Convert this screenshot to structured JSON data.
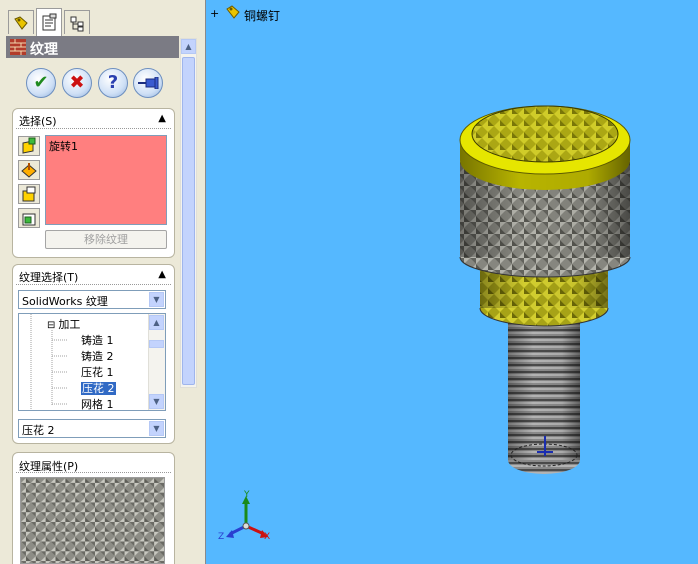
{
  "tabs": [
    {
      "name": "featuremanager-tab"
    },
    {
      "name": "propertymanager-tab"
    },
    {
      "name": "configurationmanager-tab"
    }
  ],
  "pm": {
    "title": "纹理",
    "actions": [
      {
        "name": "ok-button",
        "glyph": "✔",
        "color": "#1f8a1f"
      },
      {
        "name": "cancel-button",
        "glyph": "✖",
        "color": "#cc1111"
      },
      {
        "name": "help-button",
        "glyph": "?",
        "color": "#2a3fb0"
      },
      {
        "name": "pin-button",
        "glyph": "⊸",
        "color": "#2a3fb0"
      }
    ],
    "selection": {
      "header": "选择(S)",
      "item": "旋转1",
      "remove_button": "移除纹理"
    },
    "texture_select": {
      "header": "纹理选择(T)",
      "library_combo": "SolidWorks 纹理",
      "tree": [
        {
          "label": "加工",
          "indent": 1,
          "toggle": "⊟"
        },
        {
          "label": "铸造 1",
          "indent": 2
        },
        {
          "label": "铸造 2",
          "indent": 2
        },
        {
          "label": "压花 1",
          "indent": 2
        },
        {
          "label": "压花 2",
          "indent": 2,
          "selected": true
        },
        {
          "label": "网格 1",
          "indent": 2
        }
      ],
      "selected_combo": "压花 2"
    },
    "texture_props": {
      "header": "纹理属性(P)"
    }
  },
  "viewport": {
    "breadcrumb_expander": "+",
    "breadcrumb": "铜螺钉",
    "triad": {
      "x": "X",
      "y": "Y",
      "z": "Z"
    },
    "colors": {
      "background": "#55B8FF",
      "rim": "#E6E600",
      "knurl": "#8B8B84",
      "thread": "#7E7E7E"
    }
  }
}
